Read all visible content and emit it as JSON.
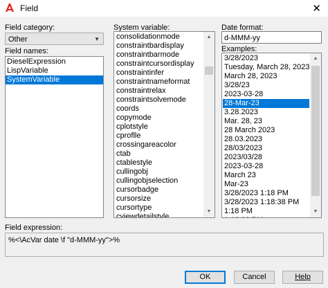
{
  "window": {
    "title": "Field"
  },
  "colors": {
    "selection": "#0078d7",
    "app_icon": "#e2231a"
  },
  "field_category": {
    "label": "Field category:",
    "value": "Other"
  },
  "field_names": {
    "label": "Field names:",
    "items": [
      "DieselExpression",
      "LispVariable",
      "SystemVariable"
    ],
    "selected_index": 2
  },
  "system_variable": {
    "label": "System variable:",
    "items": [
      "consolidationmode",
      "constraintbardisplay",
      "constraintbarmode",
      "constraintcursordisplay",
      "constraintinfer",
      "constraintnameformat",
      "constraintrelax",
      "constraintsolvemode",
      "coords",
      "copymode",
      "cplotstyle",
      "cproflle",
      "crossingareacolor",
      "ctab",
      "ctablestyle",
      "cullingobj",
      "cullingobjselection",
      "cursorbadge",
      "cursorsize",
      "cursortype",
      "cviewdetailstyle",
      "cviewsectionstyle",
      "cyport",
      "datalinknotify",
      "date",
      "dblclkedit"
    ],
    "selected_index": 24
  },
  "date_format": {
    "label": "Date format:",
    "value": "d-MMM-yy"
  },
  "examples": {
    "label": "Examples:",
    "items": [
      "3/28/2023",
      "Tuesday, March 28, 2023",
      "March 28, 2023",
      "3/28/23",
      "2023-03-28",
      "28-Mar-23",
      "3.28.2023",
      "Mar. 28, 23",
      "28 March 2023",
      "28.03.2023",
      "28/03/2023",
      "2023/03/28",
      "2023-03-28",
      "March 23",
      "Mar-23",
      "3/28/2023 1:18 PM",
      "3/28/2023 1:18:38 PM",
      "1:18 PM",
      "1:18:38 PM",
      "13:18",
      "13:18:38",
      "Tuesday, March 28, 2023 (Regio",
      "Tuesday, March 28, 2023 1:18 P"
    ],
    "selected_index": 5
  },
  "field_expression": {
    "label": "Field expression:",
    "value": "%<\\AcVar date \\f \"d-MMM-yy\">%"
  },
  "buttons": {
    "ok": "OK",
    "cancel": "Cancel",
    "help": "Help"
  }
}
